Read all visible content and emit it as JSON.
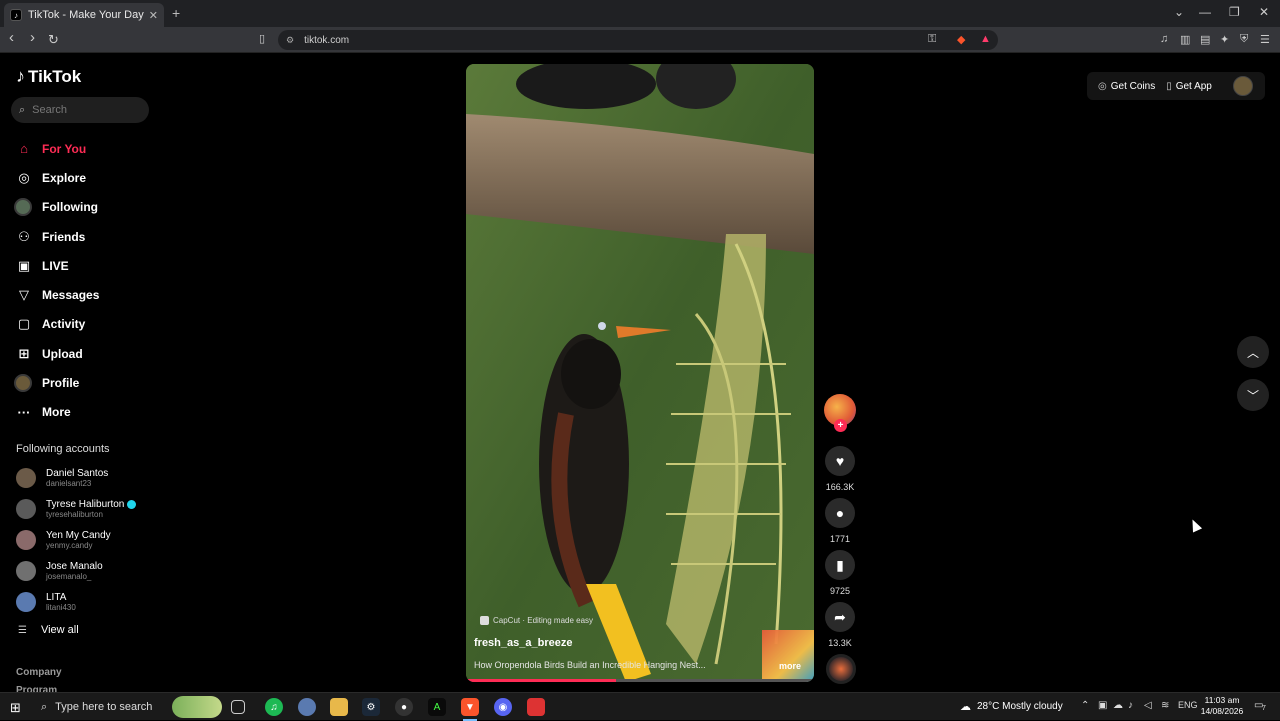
{
  "browser": {
    "tab_title": "TikTok - Make Your Day",
    "tab_close": "✕",
    "new_tab": "+",
    "url": "tiktok.com",
    "window_controls": [
      "⌄",
      "—",
      "❐",
      "✕"
    ],
    "nav": {
      "back": "‹",
      "forward": "›",
      "reload": "↻"
    }
  },
  "sidebar": {
    "logo_text": "TikTok",
    "search_placeholder": "Search",
    "menu": [
      {
        "label": "For You",
        "icon": "home-icon",
        "active": true
      },
      {
        "label": "Explore",
        "icon": "compass-icon"
      },
      {
        "label": "Following",
        "icon": "avatar"
      },
      {
        "label": "Friends",
        "icon": "friends-icon"
      },
      {
        "label": "LIVE",
        "icon": "live-icon"
      },
      {
        "label": "Messages",
        "icon": "send-icon"
      },
      {
        "label": "Activity",
        "icon": "inbox-icon"
      },
      {
        "label": "Upload",
        "icon": "plus-square-icon"
      },
      {
        "label": "Profile",
        "icon": "avatar"
      },
      {
        "label": "More",
        "icon": "ellipsis-icon"
      }
    ],
    "following_title": "Following accounts",
    "following": [
      {
        "name": "Daniel Santos",
        "user": "danielsant23",
        "color": "#6b5a48"
      },
      {
        "name": "Tyrese Haliburton",
        "user": "tyresehaliburton",
        "color": "#5a5a5a",
        "verified": true
      },
      {
        "name": "Yen My Candy",
        "user": "yenmy.candy",
        "color": "#8a6a6a"
      },
      {
        "name": "Jose Manalo",
        "user": "josemanalo_",
        "color": "#707070"
      },
      {
        "name": "LITA",
        "user": "litani430",
        "color": "#5a7ab0"
      }
    ],
    "view_all": "View all",
    "company": "Company",
    "program": "Program"
  },
  "video": {
    "capcut": "CapCut · Editing made easy",
    "username": "fresh_as_a_breeze",
    "description": "How Oropendola Birds Build an Incredible Hanging Nest...",
    "more": "more",
    "progress": 0.43
  },
  "actions": {
    "follow_plus": "+",
    "likes": "166.3K",
    "comments": "1771",
    "saves": "9725",
    "shares": "13.3K"
  },
  "topbar": {
    "get_coins": "Get Coins",
    "get_app": "Get App"
  },
  "taskbar": {
    "search_placeholder": "Type here to search",
    "weather": "28°C  Mostly cloudy",
    "lang": "ENG",
    "time": "11:03 am",
    "date": "14/08/2026",
    "notif_count": "7"
  }
}
